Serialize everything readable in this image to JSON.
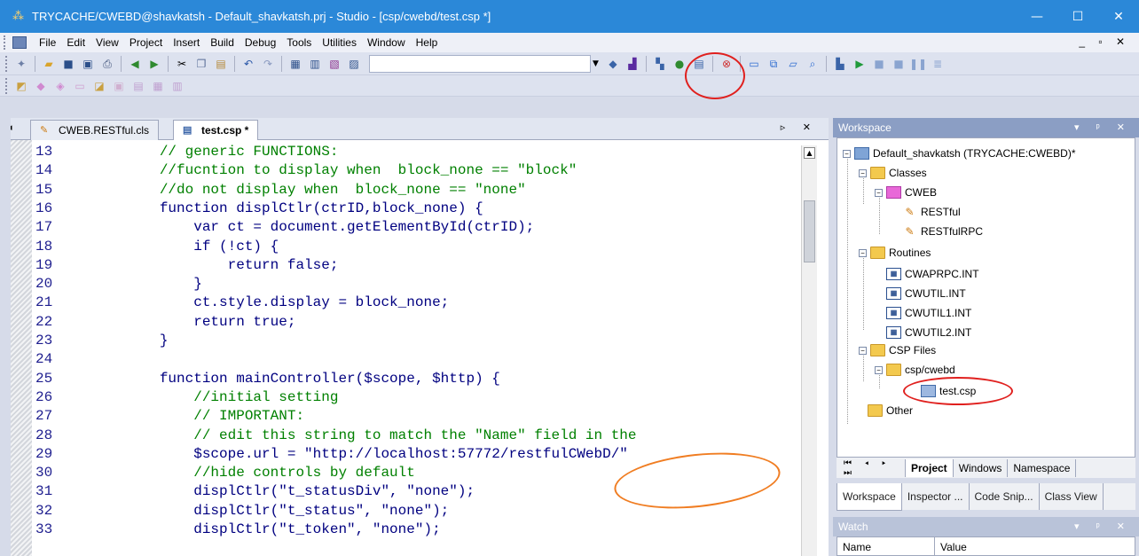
{
  "window": {
    "title": "TRYCACHE/CWEBD@shavkatsh - Default_shavkatsh.prj - Studio - [csp/cwebd/test.csp *]",
    "min_glyph": "—",
    "max_glyph": "☐",
    "close_glyph": "✕"
  },
  "menu": {
    "items": [
      "File",
      "Edit",
      "View",
      "Project",
      "Insert",
      "Build",
      "Debug",
      "Tools",
      "Utilities",
      "Window",
      "Help"
    ],
    "mdi_controls": "_ ▫ ✕"
  },
  "tabs": {
    "left_arrow": "◂",
    "items": [
      {
        "label": "CWEB.RESTful.cls"
      },
      {
        "label": "test.csp *"
      }
    ],
    "controls": "▹ ✕"
  },
  "editor": {
    "lines": [
      {
        "num": "13",
        "text": "        // generic FUNCTIONS:",
        "kind": "comment"
      },
      {
        "num": "14",
        "text": "        //fucntion to display when  block_none == \"block\"",
        "kind": "comment"
      },
      {
        "num": "15",
        "text": "        //do not display when  block_none == \"none\"",
        "kind": "comment"
      },
      {
        "num": "16",
        "text": "        function displCtlr(ctrID,block_none) {",
        "kind": "code"
      },
      {
        "num": "17",
        "text": "            var ct = document.getElementById(ctrID);",
        "kind": "code"
      },
      {
        "num": "18",
        "text": "            if (!ct) {",
        "kind": "code"
      },
      {
        "num": "19",
        "text": "                return false;",
        "kind": "code"
      },
      {
        "num": "20",
        "text": "            }",
        "kind": "code"
      },
      {
        "num": "21",
        "text": "            ct.style.display = block_none;",
        "kind": "code"
      },
      {
        "num": "22",
        "text": "            return true;",
        "kind": "code"
      },
      {
        "num": "23",
        "text": "        }",
        "kind": "code"
      },
      {
        "num": "24",
        "text": "",
        "kind": "code"
      },
      {
        "num": "25",
        "text": "        function mainController($scope, $http) {",
        "kind": "code"
      },
      {
        "num": "26",
        "text": "            //initial setting",
        "kind": "comment"
      },
      {
        "num": "27",
        "text": "            // IMPORTANT:",
        "kind": "comment"
      },
      {
        "num": "28",
        "text": "            // edit this string to match the \"Name\" field in the",
        "kind": "comment"
      },
      {
        "num": "29",
        "text": "            $scope.url = \"http://localhost:57772/restfulCWebD/\"",
        "kind": "code"
      },
      {
        "num": "30",
        "text": "            //hide controls by default",
        "kind": "comment"
      },
      {
        "num": "31",
        "text": "            displCtlr(\"t_statusDiv\", \"none\");",
        "kind": "code"
      },
      {
        "num": "32",
        "text": "            displCtlr(\"t_status\", \"none\");",
        "kind": "code"
      },
      {
        "num": "33",
        "text": "            displCtlr(\"t_token\", \"none\");",
        "kind": "code"
      }
    ]
  },
  "workspace": {
    "title": "Workspace",
    "controls": "▾ ᵖ ✕",
    "tree": {
      "project": "Default_shavkatsh  (TRYCACHE:CWEBD)*",
      "classes": "Classes",
      "cweb": "CWEB",
      "restful": "RESTful",
      "restfulrpc": "RESTfulRPC",
      "routines": "Routines",
      "r1": "CWAPRPC.INT",
      "r2": "CWUTIL.INT",
      "r3": "CWUTIL1.INT",
      "r4": "CWUTIL2.INT",
      "cspfiles": "CSP Files",
      "cspcwebd": "csp/cwebd",
      "testcsp": "test.csp",
      "other": "Other"
    },
    "nav_arrows": "⏮ ◂ ▸ ⏭",
    "view_tabs": [
      "Project",
      "Windows",
      "Namespace"
    ],
    "bottom_tabs": [
      "Workspace",
      "Inspector ...",
      "Code Snip...",
      "Class View"
    ]
  },
  "watch": {
    "title": "Watch",
    "controls": "▾ ᵖ ✕",
    "columns": [
      "Name",
      "Value"
    ]
  },
  "colors": {
    "titlebar": "#2b88d8",
    "annotation_red": "#e0201e",
    "annotation_orange": "#f07d22"
  }
}
